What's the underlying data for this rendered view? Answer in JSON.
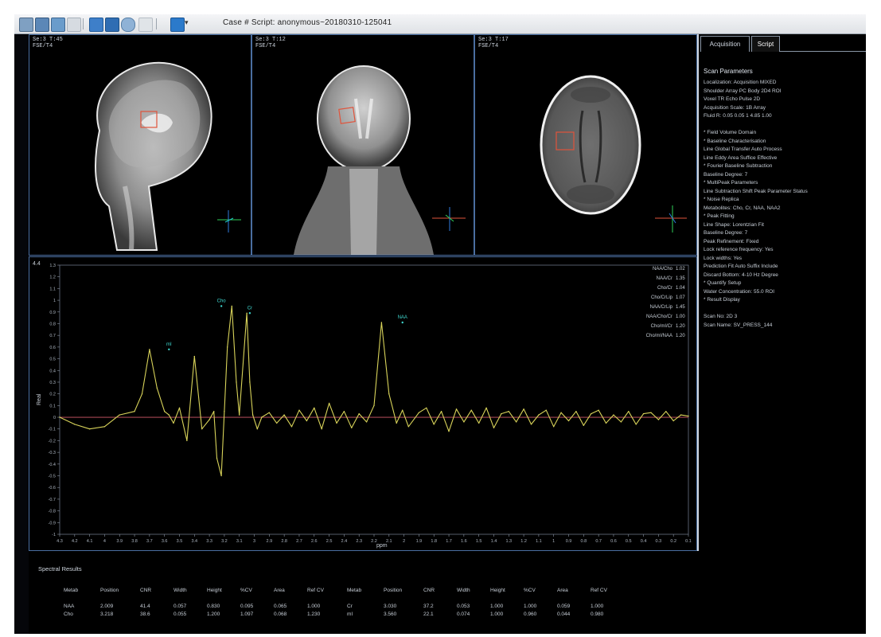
{
  "toolbar": {
    "case_label": "Case #  Script:  anonymous~20180310-125041",
    "icons": [
      "open-icon",
      "save-icon",
      "export-icon",
      "copy-icon",
      "layout-icon",
      "report-icon",
      "view-icon",
      "settings-icon",
      "display-icon"
    ]
  },
  "views": [
    {
      "label_1": "Se:3 T:45",
      "label_2": "FSE/T4"
    },
    {
      "label_1": "Se:3 T:12",
      "label_2": "FSE/T4"
    },
    {
      "label_1": "Se:3 T:17",
      "label_2": "FSE/T4"
    }
  ],
  "side": {
    "tabs": [
      "Acquisition",
      "Script"
    ],
    "title": "Scan Parameters",
    "params": [
      "Localization: Acquisition MIXED",
      "Shoulder Array PC Body 2D4 ROI",
      "Voxel TR Echo Pulse 2D",
      "Acquisition Scale: 1B Array",
      "Fluid R: 0.05 0.05 1 4.85 1.00",
      "",
      "* Field Volume Domain",
      "* Baseline Characterisation",
      "   Line Global Transfer Auto Process",
      "   Line Eddy Area Suffice Effective",
      "* Fourier Baseline Subtraction",
      "   Baseline Degree: 7",
      "* MultiPeak Parameters",
      "   Line Subtraction Shift Peak Parameter Status",
      "* Noise Replica",
      "   Metabolites: Cho, Cr, NAA, NAA2",
      "* Peak Fitting",
      "   Line Shape: Lorentzian Fit",
      "   Baseline Degree: 7",
      "   Peak Refinement: Fixed",
      "   Lock reference frequency: Yes",
      "   Lock widths: Yes",
      "   Prediction Fit Auto Suffix Include",
      "   Discard Bottom: 4-10 Hz Degree",
      "* Quantify Setup",
      "   Water Concentration: 55.0 ROI",
      "* Result Display",
      "",
      "Scan No: 2D 3",
      "Scan Name: SV_PRESS_144"
    ]
  },
  "spectrum": {
    "y_axis_label": "Real",
    "x_axis_label": "ppm",
    "corner_label": "4.4",
    "y_ticks": [
      "1.3",
      "1.2",
      "1.1",
      "1",
      "0.9",
      "0.8",
      "0.7",
      "0.6",
      "0.5",
      "0.4",
      "0.3",
      "0.2",
      "0.1",
      "0",
      "-0.1",
      "-0.2",
      "-0.3",
      "-0.4",
      "-0.5",
      "-0.6",
      "-0.7",
      "-0.8",
      "-0.9",
      "-1"
    ],
    "x_ticks": [
      "4.3",
      "4.2",
      "4.1",
      "4",
      "3.9",
      "3.8",
      "3.7",
      "3.6",
      "3.5",
      "3.4",
      "3.3",
      "3.2",
      "3.1",
      "3",
      "2.9",
      "2.8",
      "2.7",
      "2.6",
      "2.5",
      "2.4",
      "2.3",
      "2.2",
      "2.1",
      "2",
      "1.9",
      "1.8",
      "1.7",
      "1.6",
      "1.5",
      "1.4",
      "1.3",
      "1.2",
      "1.1",
      "1",
      "0.9",
      "0.8",
      "0.7",
      "0.6",
      "0.5",
      "0.4",
      "0.3",
      "0.2",
      "0.1"
    ],
    "peak_labels": [
      {
        "name": "mI",
        "ppm": 3.57,
        "value": 0.58
      },
      {
        "name": "Cho",
        "ppm": 3.22,
        "value": 0.95
      },
      {
        "name": "Cr",
        "ppm": 3.03,
        "value": 0.89
      },
      {
        "name": "NAA",
        "ppm": 2.01,
        "value": 0.81
      }
    ],
    "ratios": [
      {
        "label": "NAA/Cho",
        "value": "1.02"
      },
      {
        "label": "NAA/Cr",
        "value": "1.35"
      },
      {
        "label": "Cho/Cr",
        "value": "1.04"
      },
      {
        "label": "Cho/CrLip",
        "value": "1.07"
      },
      {
        "label": "NAA/CrLip",
        "value": "1.45"
      },
      {
        "label": "NAA/Cho/Cr",
        "value": "1.00"
      },
      {
        "label": "Cho/mI/Cr",
        "value": "1.20"
      },
      {
        "label": "Cho/mI/NAA",
        "value": "1.20"
      }
    ]
  },
  "results": {
    "title": "Spectral Results",
    "headers": [
      "Metab",
      "Position",
      "CNR",
      "Width",
      "Height",
      "%CV",
      "Area",
      "Ref CV"
    ],
    "left_rows": [
      [
        "NAA",
        "2.009",
        "41.4",
        "0.057",
        "0.830",
        "0.095",
        "0.065",
        "1.000"
      ],
      [
        "Cho",
        "3.218",
        "38.6",
        "0.055",
        "1.200",
        "1.097",
        "0.068",
        "1.230"
      ]
    ],
    "right_rows": [
      [
        "Cr",
        "3.030",
        "37.2",
        "0.053",
        "1.000",
        "1.000",
        "0.059",
        "1.000"
      ],
      [
        "mI",
        "3.560",
        "22.1",
        "0.074",
        "1.000",
        "0.960",
        "0.044",
        "0.980"
      ]
    ]
  },
  "chart_data": {
    "type": "line",
    "title": "",
    "xlabel": "ppm",
    "ylabel": "Real",
    "xlim": [
      4.3,
      0.1
    ],
    "ylim": [
      -1.0,
      1.3
    ],
    "x_reversed": true,
    "series": [
      {
        "x": [
          4.3,
          4.2,
          4.1,
          4.0,
          3.9,
          3.8,
          3.75,
          3.7,
          3.65,
          3.6,
          3.57,
          3.54,
          3.5,
          3.45,
          3.4,
          3.35,
          3.3,
          3.27,
          3.25,
          3.22,
          3.2,
          3.18,
          3.15,
          3.12,
          3.1,
          3.05,
          3.03,
          3.01,
          2.98,
          2.95,
          2.9,
          2.85,
          2.8,
          2.75,
          2.7,
          2.65,
          2.6,
          2.55,
          2.5,
          2.45,
          2.4,
          2.35,
          2.3,
          2.25,
          2.2,
          2.15,
          2.1,
          2.05,
          2.01,
          1.97,
          1.9,
          1.85,
          1.8,
          1.75,
          1.7,
          1.65,
          1.6,
          1.55,
          1.5,
          1.45,
          1.4,
          1.35,
          1.3,
          1.25,
          1.2,
          1.15,
          1.1,
          1.05,
          1.0,
          0.95,
          0.9,
          0.85,
          0.8,
          0.75,
          0.7,
          0.65,
          0.6,
          0.55,
          0.5,
          0.45,
          0.4,
          0.35,
          0.3,
          0.25,
          0.2,
          0.15,
          0.1
        ],
        "y": [
          0.0,
          -0.06,
          -0.1,
          -0.08,
          0.02,
          0.05,
          0.2,
          0.58,
          0.25,
          0.05,
          0.02,
          -0.05,
          0.08,
          -0.2,
          0.52,
          -0.1,
          -0.02,
          0.05,
          -0.35,
          -0.5,
          0.05,
          0.6,
          0.95,
          0.3,
          0.02,
          0.89,
          0.3,
          0.02,
          -0.1,
          0.0,
          0.04,
          -0.05,
          0.02,
          -0.08,
          0.06,
          -0.03,
          0.08,
          -0.1,
          0.12,
          -0.05,
          0.05,
          -0.09,
          0.03,
          -0.04,
          0.1,
          0.81,
          0.2,
          -0.05,
          0.06,
          -0.08,
          0.04,
          0.08,
          -0.06,
          0.05,
          -0.12,
          0.07,
          -0.04,
          0.06,
          -0.05,
          0.08,
          -0.09,
          0.03,
          0.05,
          -0.04,
          0.07,
          -0.06,
          0.02,
          0.06,
          -0.08,
          0.04,
          -0.03,
          0.05,
          -0.07,
          0.03,
          0.06,
          -0.05,
          0.02,
          -0.04,
          0.05,
          -0.06,
          0.03,
          0.04,
          -0.02,
          0.05,
          -0.03,
          0.02,
          0.01
        ]
      }
    ]
  }
}
